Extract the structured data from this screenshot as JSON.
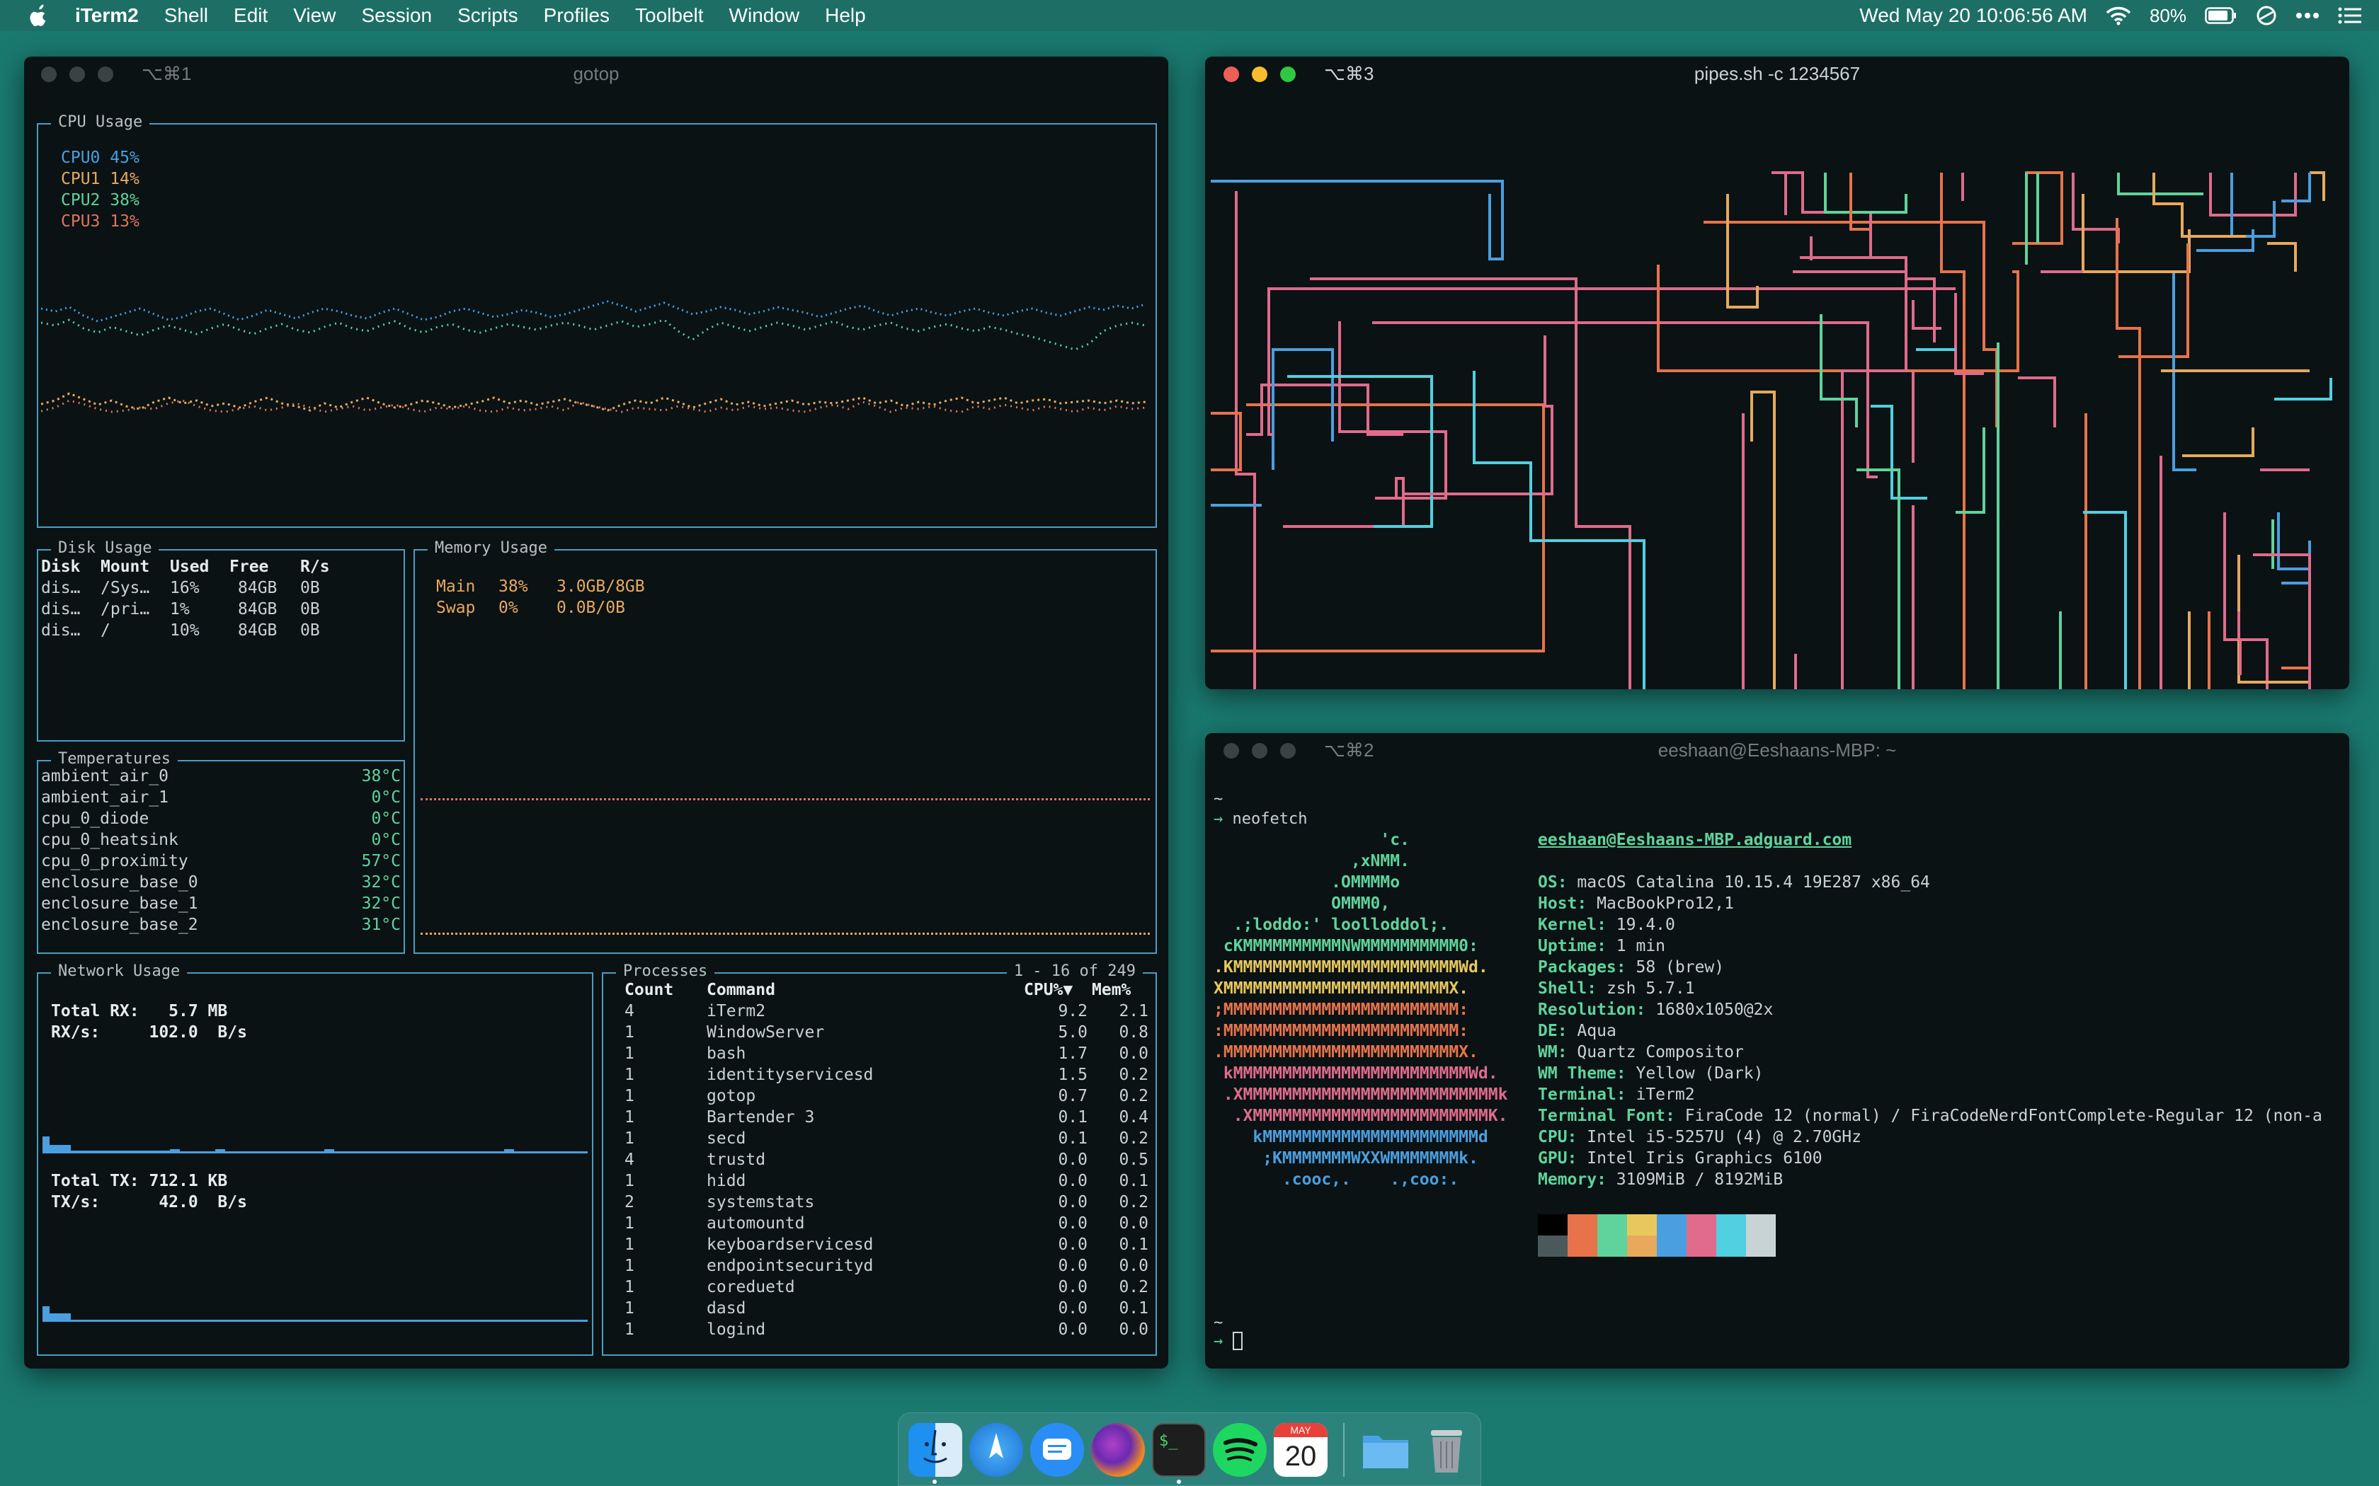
{
  "menubar": {
    "app": "iTerm2",
    "items": [
      "Shell",
      "Edit",
      "View",
      "Session",
      "Scripts",
      "Profiles",
      "Toolbelt",
      "Window",
      "Help"
    ],
    "datetime": "Wed May 20  10:06:56 AM",
    "battery": "80%",
    "icons": [
      "apple-icon",
      "wifi-icon",
      "battery-icon",
      "focus-icon",
      "more-icon",
      "list-icon"
    ]
  },
  "win1": {
    "title": "gotop",
    "shortcut": "⌥⌘1",
    "cpu": {
      "title": "CPU Usage",
      "cores": [
        {
          "label": "CPU0",
          "value": "45%",
          "color": "#4a9fe0"
        },
        {
          "label": "CPU1",
          "value": "14%",
          "color": "#e8a95c"
        },
        {
          "label": "CPU2",
          "value": "38%",
          "color": "#5fd39b"
        },
        {
          "label": "CPU3",
          "value": "13%",
          "color": "#e0745c"
        }
      ]
    },
    "disk": {
      "title": "Disk Usage",
      "headers": [
        "Disk",
        "Mount",
        "Used",
        "Free",
        "R/s"
      ],
      "rows": [
        [
          "dis…",
          "/Sys…",
          "16%",
          "84GB",
          "0B"
        ],
        [
          "dis…",
          "/pri…",
          "1%",
          "84GB",
          "0B"
        ],
        [
          "dis…",
          "/",
          "10%",
          "84GB",
          "0B"
        ]
      ]
    },
    "memory": {
      "title": "Memory Usage",
      "rows": [
        [
          "Main",
          "38%",
          "3.0GB/8GB"
        ],
        [
          "Swap",
          "0%",
          "0.0B/0B"
        ]
      ]
    },
    "temps": {
      "title": "Temperatures",
      "rows": [
        [
          "ambient_air_0",
          "38°C"
        ],
        [
          "ambient_air_1",
          "0°C"
        ],
        [
          "cpu_0_diode",
          "0°C"
        ],
        [
          "cpu_0_heatsink",
          "0°C"
        ],
        [
          "cpu_0_proximity",
          "57°C"
        ],
        [
          "enclosure_base_0",
          "32°C"
        ],
        [
          "enclosure_base_1",
          "32°C"
        ],
        [
          "enclosure_base_2",
          "31°C"
        ]
      ]
    },
    "network": {
      "title": "Network Usage",
      "rx_total": "Total RX:   5.7 MB",
      "rx_rate": "RX/s:     102.0  B/s",
      "tx_total": "Total TX: 712.1 KB",
      "tx_rate": "TX/s:      42.0  B/s"
    },
    "processes": {
      "title": "Processes",
      "range": "1 - 16 of 249",
      "headers": [
        "Count",
        "Command",
        "CPU%▼",
        "Mem%"
      ],
      "rows": [
        [
          "4",
          "iTerm2",
          "9.2",
          "2.1"
        ],
        [
          "1",
          "WindowServer",
          "5.0",
          "0.8"
        ],
        [
          "1",
          "bash",
          "1.7",
          "0.0"
        ],
        [
          "1",
          "identityservicesd",
          "1.5",
          "0.2"
        ],
        [
          "1",
          "gotop",
          "0.7",
          "0.2"
        ],
        [
          "1",
          "Bartender 3",
          "0.1",
          "0.4"
        ],
        [
          "1",
          "secd",
          "0.1",
          "0.2"
        ],
        [
          "4",
          "trustd",
          "0.0",
          "0.5"
        ],
        [
          "1",
          "hidd",
          "0.0",
          "0.1"
        ],
        [
          "2",
          "systemstats",
          "0.0",
          "0.2"
        ],
        [
          "1",
          "automountd",
          "0.0",
          "0.0"
        ],
        [
          "1",
          "keyboardservicesd",
          "0.0",
          "0.1"
        ],
        [
          "1",
          "endpointsecurityd",
          "0.0",
          "0.0"
        ],
        [
          "1",
          "coreduetd",
          "0.0",
          "0.2"
        ],
        [
          "1",
          "dasd",
          "0.0",
          "0.1"
        ],
        [
          "1",
          "logind",
          "0.0",
          "0.0"
        ]
      ]
    }
  },
  "win3": {
    "title": "pipes.sh -c 1234567",
    "shortcut": "⌥⌘3"
  },
  "win2": {
    "title": "eeshaan@Eeshaans-MBP: ~",
    "shortcut": "⌥⌘2",
    "tilde": "~",
    "prompt": "→",
    "command": "neofetch",
    "art": [
      {
        "t": "                 'c.",
        "c": "#5fd39b"
      },
      {
        "t": "              ,xNMM.",
        "c": "#5fd39b"
      },
      {
        "t": "            .OMMMMo",
        "c": "#5fd39b"
      },
      {
        "t": "            OMMM0,",
        "c": "#5fd39b"
      },
      {
        "t": "  .;loddo:' loolloddol;.",
        "c": "#5fd39b"
      },
      {
        "t": " cKMMMMMMMMMMNWMMMMMMMMMM0:",
        "c": "#5fd39b"
      },
      {
        "t": ".KMMMMMMMMMMMMMMMMMMMMMMMWd.",
        "c": "#e8c85c"
      },
      {
        "t": "XMMMMMMMMMMMMMMMMMMMMMMMX.",
        "c": "#e8c85c"
      },
      {
        "t": ";MMMMMMMMMMMMMMMMMMMMMMMM:",
        "c": "#e8734a"
      },
      {
        "t": ":MMMMMMMMMMMMMMMMMMMMMMMM:",
        "c": "#e8734a"
      },
      {
        "t": ".MMMMMMMMMMMMMMMMMMMMMMMMX.",
        "c": "#e8734a"
      },
      {
        "t": " kMMMMMMMMMMMMMMMMMMMMMMMMWd.",
        "c": "#e06b8b"
      },
      {
        "t": " .XMMMMMMMMMMMMMMMMMMMMMMMMMMk",
        "c": "#e06b8b"
      },
      {
        "t": "  .XMMMMMMMMMMMMMMMMMMMMMMMMK.",
        "c": "#e06b8b"
      },
      {
        "t": "    kMMMMMMMMMMMMMMMMMMMMMMd",
        "c": "#4a9fe0"
      },
      {
        "t": "     ;KMMMMMMMWXXWMMMMMMMk.",
        "c": "#4a9fe0"
      },
      {
        "t": "       .cooc,.    .,coo:.",
        "c": "#4a9fe0"
      }
    ],
    "userhost": "eeshaan@Eeshaans-MBP.adguard.com",
    "info": [
      [
        "OS:",
        "macOS Catalina 10.15.4 19E287 x86_64"
      ],
      [
        "Host:",
        "MacBookPro12,1"
      ],
      [
        "Kernel:",
        "19.4.0"
      ],
      [
        "Uptime:",
        "1 min"
      ],
      [
        "Packages:",
        "58 (brew)"
      ],
      [
        "Shell:",
        "zsh 5.7.1"
      ],
      [
        "Resolution:",
        "1680x1050@2x"
      ],
      [
        "DE:",
        "Aqua"
      ],
      [
        "WM:",
        "Quartz Compositor"
      ],
      [
        "WM Theme:",
        "Yellow (Dark)"
      ],
      [
        "Terminal:",
        "iTerm2"
      ],
      [
        "Terminal Font:",
        "FiraCode 12 (normal) / FiraCodeNerdFontComplete-Regular 12 (non-a"
      ],
      [
        "CPU:",
        "Intel i5-5257U (4) @ 2.70GHz"
      ],
      [
        "GPU:",
        "Intel Iris Graphics 6100"
      ],
      [
        "Memory:",
        "3109MiB / 8192MiB"
      ]
    ],
    "palette_top": [
      "#000000",
      "#e8734a",
      "#5fd39b",
      "#e8c85c",
      "#4a9fe0",
      "#e06b8b",
      "#50d0e0",
      "#c8d3d5"
    ],
    "palette_bottom": [
      "#4a5a5c",
      "#e8734a",
      "#5fd39b",
      "#e8a95c",
      "#4a9fe0",
      "#e06b8b",
      "#50d0e0",
      "#c8d3d5"
    ]
  },
  "dock": {
    "items": [
      "finder-icon",
      "safari-icon",
      "messages-icon",
      "firefox-icon",
      "terminal-icon",
      "spotify-icon",
      "calendar-icon",
      "folder-icon",
      "trash-icon"
    ],
    "calendar": {
      "month": "MAY",
      "day": "20"
    }
  }
}
